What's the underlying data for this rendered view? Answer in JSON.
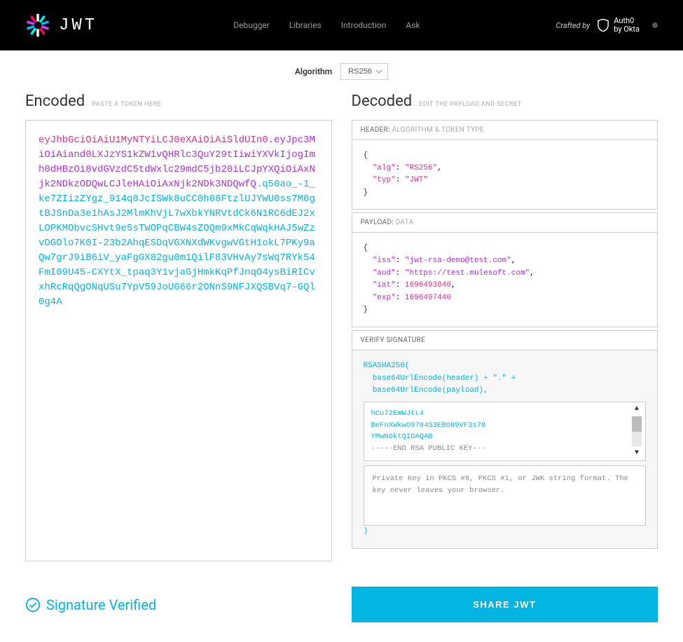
{
  "header": {
    "logo_text": "JWT",
    "nav": [
      "Debugger",
      "Libraries",
      "Introduction",
      "Ask"
    ],
    "crafted_by": "Crafted by",
    "auth0_line1": "Auth0",
    "auth0_line2": "by Okta"
  },
  "algorithm": {
    "label": "Algorithm",
    "value": "RS256"
  },
  "encoded": {
    "title": "Encoded",
    "subtitle": "PASTE A TOKEN HERE",
    "header_part": "eyJhbGciOiAiU1MyNTYiLCJ0eXAiOiAiSldUIn0",
    "payload_part": ".eyJpc3MiOiAiand0LXJzYS1kZW1vQHRlc3QuY29tIiwiYXVkIjogImh0dHBzOi8vdGVzdC5tdWxlc29mdC5jb20iLCJpYXQiOiAxNjk2NDkzODQwLCJleHAiOiAxNjk2NDk3NDQwfQ",
    "sig_part": ".q50ao_-1_ke7ZIizZYgz_914q8JcISWk8uCC0h08FtzlUJYWU0ss7M0gtBJSnDa3e1hAsJ2MlmKhVjL7wXbkYNRVtdCk6N1RC6dEJ2xLOPKMObvcSHvt9e5sTWOPqCBW4sZOQm9xMkCqWqkHAJ5wZzvDGOlo7K0I-23b2AhqESDqVGXNXdWKvgwVGtH1okL7PKy9aQw7grJ9iB6iV_yaFgGX82gu0m1QilF83VHvAy7sWq7RYk54FmI09U45-CXYtX_tpaq3Y1vjaGjHmkKqPfJnqO4ysBiRICvxhRcRqQgONqUSu7YpV59JoUG66r2ONnS9NFJXQSBVq7-GQl0g4A"
  },
  "decoded": {
    "title": "Decoded",
    "subtitle": "EDIT THE PAYLOAD AND SECRET",
    "header_section": {
      "label": "HEADER:",
      "label2": "ALGORITHM & TOKEN TYPE",
      "alg_key": "\"alg\"",
      "alg_val": "\"RS256\"",
      "typ_key": "\"typ\"",
      "typ_val": "\"JWT\""
    },
    "payload_section": {
      "label": "PAYLOAD:",
      "label2": "DATA",
      "iss_key": "\"iss\"",
      "iss_val": "\"jwt-rsa-demo@test.com\"",
      "aud_key": "\"aud\"",
      "aud_val": "\"https://test.mulesoft.com\"",
      "iat_key": "\"iat\"",
      "iat_val": "1696493840",
      "exp_key": "\"exp\"",
      "exp_val": "1696497440"
    },
    "signature_section": {
      "label": "VERIFY SIGNATURE",
      "algo_fn": "RSASHA256(",
      "line1": "base64UrlEncode(header) + \".\" +",
      "line2": "base64UrlEncode(payload),",
      "public_key_lines": [
        "hCu72EmWJtL4",
        "BeFnXWkwO9704S3EBON9VF3s78",
        "YMwN6ktQIDAQAB",
        "-----END RSA PUBLIC KEY---"
      ],
      "private_key_placeholder": "Private Key in PKCS #8, PKCS #1, or JWK string format. The key never leaves your browser.",
      "close": ")"
    }
  },
  "status": {
    "verified": "Signature Verified",
    "share": "SHARE JWT"
  }
}
